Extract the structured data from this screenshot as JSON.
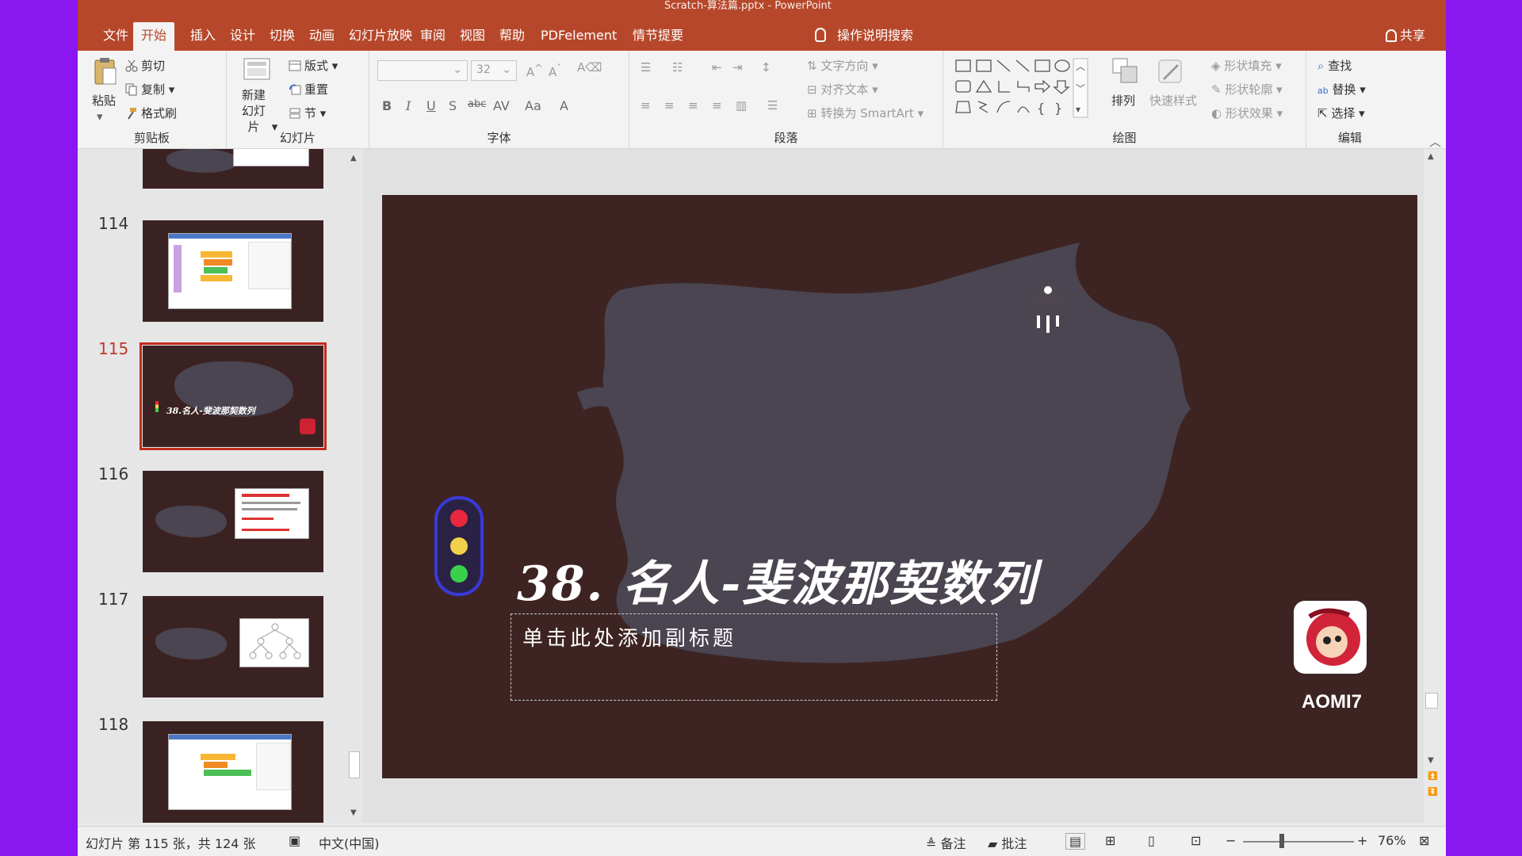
{
  "window": {
    "title": "Scratch-算法篇.pptx - PowerPoint"
  },
  "tabs": [
    "文件",
    "开始",
    "插入",
    "设计",
    "切换",
    "动画",
    "幻灯片放映",
    "审阅",
    "视图",
    "帮助",
    "PDFelement",
    "情节提要"
  ],
  "active_tab": "开始",
  "tell_me": "操作说明搜索",
  "share": "共享",
  "ribbon": {
    "clipboard": {
      "label": "剪贴板",
      "paste": "粘贴",
      "cut": "剪切",
      "copy": "复制",
      "format_painter": "格式刷"
    },
    "slides": {
      "label": "幻灯片",
      "new_slide": "新建幻灯片",
      "layout": "版式",
      "reset": "重置",
      "section": "节"
    },
    "font": {
      "label": "字体",
      "size": "32"
    },
    "paragraph": {
      "label": "段落",
      "text_direction": "文字方向",
      "align_text": "对齐文本",
      "convert_smartart": "转换为 SmartArt"
    },
    "drawing": {
      "label": "绘图",
      "arrange": "排列",
      "quick_styles": "快速样式",
      "shape_fill": "形状填充",
      "shape_outline": "形状轮廓",
      "shape_effects": "形状效果"
    },
    "editing": {
      "label": "编辑",
      "find": "查找",
      "replace": "替换",
      "select": "选择"
    }
  },
  "thumbnails": [
    {
      "num": "114",
      "kind": "screen"
    },
    {
      "num": "115",
      "kind": "title",
      "caption": "38.名人-斐波那契数列",
      "selected": true
    },
    {
      "num": "116",
      "kind": "card"
    },
    {
      "num": "117",
      "kind": "tree"
    },
    {
      "num": "118",
      "kind": "screen"
    }
  ],
  "slide": {
    "title": "38. 名人-斐波那契数列",
    "subtitle_placeholder": "单击此处添加副标题",
    "logo_text": "AOMI7",
    "traffic_light": [
      "#e8283c",
      "#f2d14a",
      "#3ad14a"
    ]
  },
  "status": {
    "slide_info": "幻灯片 第 115 张，共 124 张",
    "language": "中文(中国)",
    "notes": "备注",
    "comments": "批注",
    "zoom": "76%"
  },
  "colors": {
    "accent": "#b7472a",
    "slide_bg": "#3d2423",
    "stroke": "#4a4550",
    "selection": "#c42b1c"
  }
}
